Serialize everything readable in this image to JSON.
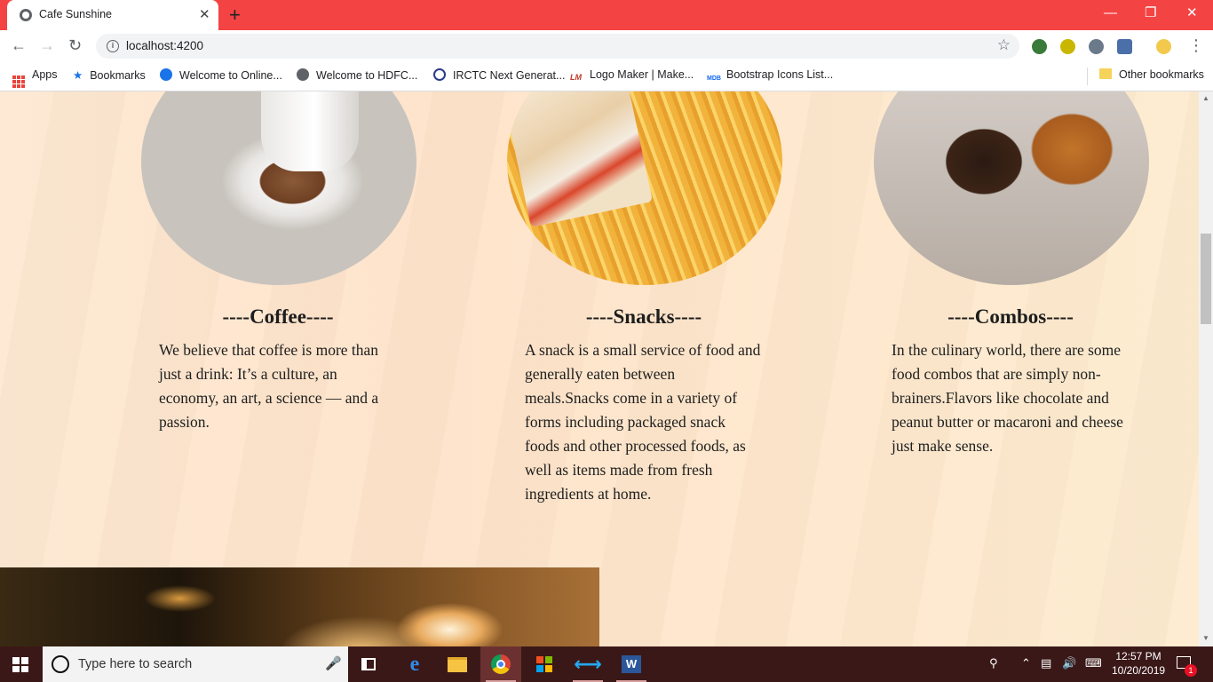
{
  "browser": {
    "tab_title": "Cafe Sunshine",
    "tab_close": "✕",
    "new_tab": "+",
    "url": "localhost:4200",
    "controls": {
      "minimize": "—",
      "restore": "❐",
      "close": "✕"
    }
  },
  "bookmarks": {
    "apps": "Apps",
    "items": [
      {
        "label": "Bookmarks",
        "icon": "star-icon"
      },
      {
        "label": "Welcome to Online...",
        "icon": "globe-icon"
      },
      {
        "label": "Welcome to HDFC...",
        "icon": "globe-icon"
      },
      {
        "label": "IRCTC Next Generat...",
        "icon": "irctc-icon"
      },
      {
        "label": "Logo Maker | Make...",
        "icon": "lm-icon"
      },
      {
        "label": "Bootstrap Icons List...",
        "icon": "mdb-icon"
      }
    ],
    "other": "Other bookmarks"
  },
  "content": {
    "cards": [
      {
        "title": "----Coffee----",
        "text": "We believe that coffee is more than just a drink: It’s a culture, an economy, an art, a science — and a passion."
      },
      {
        "title": "----Snacks----",
        "text": "A snack is a small service of food and generally eaten between meals.Snacks come in a variety of forms including packaged snack foods and other processed foods, as well as items made from fresh ingredients at home."
      },
      {
        "title": "----Combos----",
        "text": "In the culinary world, there are some food combos that are simply non-brainers.Flavors like chocolate and peanut butter or macaroni and cheese just make sense."
      }
    ]
  },
  "taskbar": {
    "search_placeholder": "Type here to search",
    "time": "12:57 PM",
    "date": "10/20/2019",
    "notification_count": "1"
  },
  "colors": {
    "tab_strip": "#f44343",
    "taskbar": "#3b1818",
    "page_background": "#fee6cc"
  }
}
